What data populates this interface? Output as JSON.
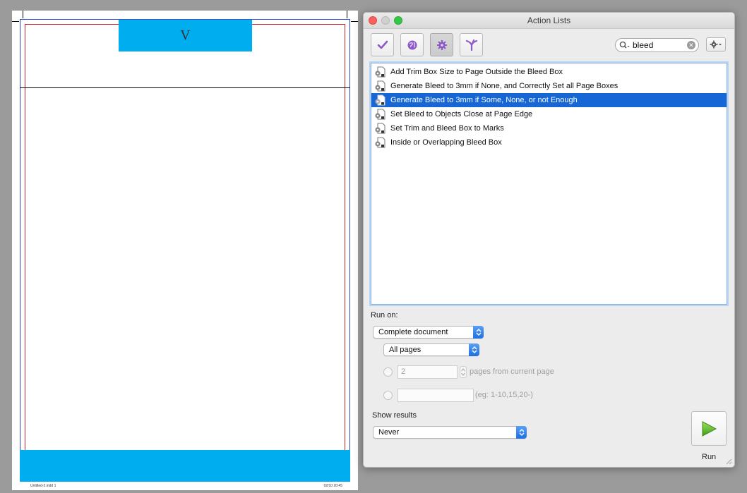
{
  "document": {
    "header_letter": "V",
    "slug_left": "Untitled-2.indd   1",
    "slug_right": "02/10   20:45"
  },
  "window": {
    "title": "Action Lists",
    "toolbar": {
      "buttons": [
        {
          "name": "check-filter-button",
          "icon": "checkmark-icon"
        },
        {
          "name": "web-filter-button",
          "icon": "globe-icon"
        },
        {
          "name": "fixup-filter-button",
          "icon": "gear-icon",
          "active": true
        },
        {
          "name": "merge-filter-button",
          "icon": "branch-icon"
        }
      ]
    },
    "search": {
      "value": "bleed"
    },
    "list": {
      "items": [
        {
          "label": "Add Trim Box Size to Page Outside the Bleed Box",
          "selected": false
        },
        {
          "label": "Generate Bleed to 3mm if None, and Correctly Set all Page Boxes",
          "selected": false
        },
        {
          "label": "Generate Bleed to 3mm if Some, None, or not Enough",
          "selected": true
        },
        {
          "label": "Set Bleed to Objects Close at Page Edge",
          "selected": false
        },
        {
          "label": "Set Trim and Bleed Box to Marks",
          "selected": false
        },
        {
          "label": "Inside or Overlapping Bleed Box",
          "selected": false
        }
      ]
    },
    "run_on": {
      "label": "Run on:",
      "scope_select": "Complete document",
      "pages_select": "All pages",
      "page_count_value": "2",
      "pages_from_current_label": "pages from current page",
      "range_value": "",
      "range_hint": "(eg: 1-10,15,20-)"
    },
    "show_results": {
      "label": "Show results",
      "select": "Never"
    },
    "run": {
      "label": "Run"
    }
  },
  "colors": {
    "accent_blue": "#1766d6",
    "page_band": "#00aeef",
    "close": "#fc605c",
    "maximize": "#34c84a",
    "run_arrow": "#5dbb2e"
  }
}
